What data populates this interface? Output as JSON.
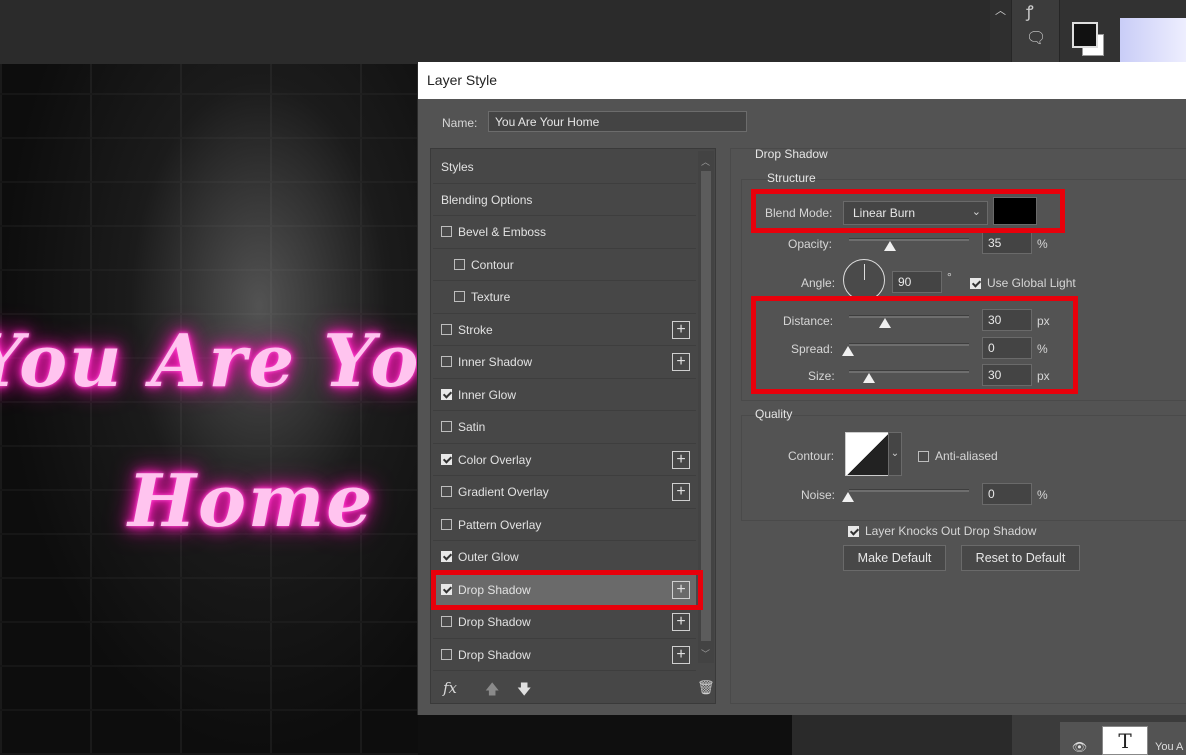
{
  "canvas": {
    "line1": "You Are Yo",
    "line2": "Home"
  },
  "layers": {
    "layer_name": "You A",
    "thumb_glyph": "T"
  },
  "dialog": {
    "title": "Layer Style",
    "name_label": "Name:",
    "name_value": "You Are Your  Home"
  },
  "styles_list": [
    {
      "label": "Styles",
      "checkbox": false,
      "plus": false
    },
    {
      "label": "Blending Options",
      "checkbox": false,
      "plus": false
    },
    {
      "label": "Bevel & Emboss",
      "checkbox": true,
      "checked": false,
      "plus": false
    },
    {
      "label": "Contour",
      "checkbox": true,
      "checked": false,
      "plus": false,
      "indent": true
    },
    {
      "label": "Texture",
      "checkbox": true,
      "checked": false,
      "plus": false,
      "indent": true
    },
    {
      "label": "Stroke",
      "checkbox": true,
      "checked": false,
      "plus": true
    },
    {
      "label": "Inner Shadow",
      "checkbox": true,
      "checked": false,
      "plus": true
    },
    {
      "label": "Inner Glow",
      "checkbox": true,
      "checked": true,
      "plus": false
    },
    {
      "label": "Satin",
      "checkbox": true,
      "checked": false,
      "plus": false
    },
    {
      "label": "Color Overlay",
      "checkbox": true,
      "checked": true,
      "plus": true
    },
    {
      "label": "Gradient Overlay",
      "checkbox": true,
      "checked": false,
      "plus": true
    },
    {
      "label": "Pattern Overlay",
      "checkbox": true,
      "checked": false,
      "plus": false
    },
    {
      "label": "Outer Glow",
      "checkbox": true,
      "checked": true,
      "plus": false
    },
    {
      "label": "Drop Shadow",
      "checkbox": true,
      "checked": true,
      "plus": true,
      "selected": true
    },
    {
      "label": "Drop Shadow",
      "checkbox": true,
      "checked": false,
      "plus": true
    },
    {
      "label": "Drop Shadow",
      "checkbox": true,
      "checked": false,
      "plus": true
    }
  ],
  "fx_bar": {
    "fx": "fx",
    "up": "🡅",
    "down": "🡇",
    "trash": "🗑"
  },
  "drop_shadow": {
    "section_title": "Drop Shadow",
    "structure_title": "Structure",
    "blend_mode_label": "Blend Mode:",
    "blend_mode_value": "Linear Burn",
    "shadow_color": "#000000",
    "opacity_label": "Opacity:",
    "opacity_value": "35",
    "opacity_unit": "%",
    "angle_label": "Angle:",
    "angle_value": "90",
    "angle_unit": "°",
    "use_global_light": "Use Global Light",
    "use_global_light_checked": true,
    "distance_label": "Distance:",
    "distance_value": "30",
    "distance_unit": "px",
    "spread_label": "Spread:",
    "spread_value": "0",
    "spread_unit": "%",
    "size_label": "Size:",
    "size_value": "30",
    "size_unit": "px",
    "quality_title": "Quality",
    "contour_label": "Contour:",
    "anti_aliased": "Anti-aliased",
    "anti_aliased_checked": false,
    "noise_label": "Noise:",
    "noise_value": "0",
    "noise_unit": "%",
    "knockout_label": "Layer Knocks Out Drop Shadow",
    "knockout_checked": true,
    "make_default": "Make Default",
    "reset_default": "Reset to Default"
  },
  "colors": {
    "highlight": "#e8000b",
    "neon_text": "#ffc4ef",
    "neon_glow": "#ff22c4"
  }
}
